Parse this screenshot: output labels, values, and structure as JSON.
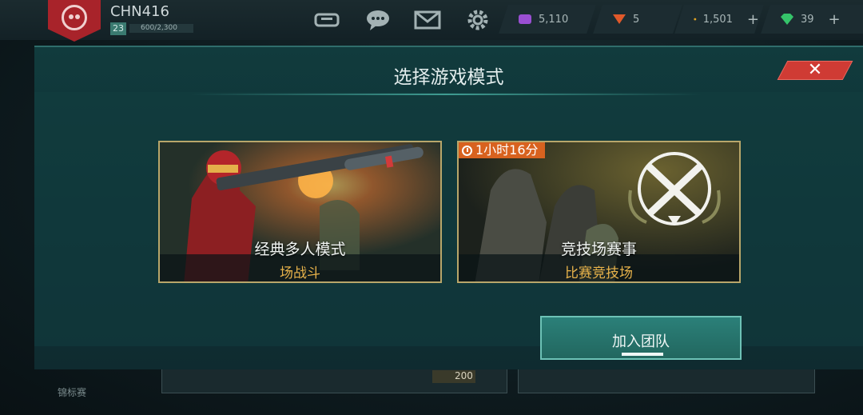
{
  "player": {
    "name": "CHN416",
    "level": "23",
    "xp": "600/2,300"
  },
  "resources": [
    {
      "value": "5,110",
      "color": "#9a4fd2",
      "icon": "purple-currency-icon",
      "has_plus": false
    },
    {
      "value": "5",
      "color": "#e0592a",
      "icon": "rank-chevron-icon",
      "has_plus": false
    },
    {
      "value": "1,501",
      "color": "#e2a321",
      "icon": "gold-credits-icon",
      "has_plus": true
    },
    {
      "value": "39",
      "color": "#35c46a",
      "icon": "green-diamond-icon",
      "has_plus": true
    }
  ],
  "top_icons": [
    "gamepad-icon",
    "chat-icon",
    "mail-icon",
    "settings-gear-icon"
  ],
  "modal": {
    "title": "选择游戏模式",
    "close_label": "✕",
    "modes": [
      {
        "name": "经典多人模式",
        "subtitle": "场战斗"
      },
      {
        "name": "竞技场赛事",
        "subtitle": "比赛竞技场",
        "timer": "1小时16分"
      }
    ],
    "join_label": "加入团队"
  },
  "background": {
    "side_label": "锦标赛",
    "card_value": "200"
  },
  "colors": {
    "accent": "#2b8079",
    "gold": "#e7b24a",
    "close": "#cf3b34",
    "timer": "#d8621f"
  }
}
